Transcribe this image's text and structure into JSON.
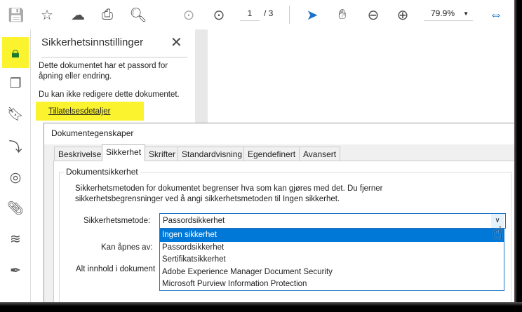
{
  "toolbar": {
    "page_current": "1",
    "page_total": "/ 3",
    "zoom": "79.9%"
  },
  "panel": {
    "title": "Sikkerhetsinnstillinger",
    "text1": "Dette dokumentet har et passord for åpning eller endring.",
    "text2": "Du kan ikke redigere dette dokumentet.",
    "link": "Tillatelsesdetaljer"
  },
  "dialog": {
    "title": "Dokumentegenskaper",
    "tabs": [
      "Beskrivelse",
      "Sikkerhet",
      "Skrifter",
      "Standardvisning",
      "Egendefinert",
      "Avansert"
    ],
    "group": "Dokumentsikkerhet",
    "desc1": "Sikkerhetsmetoden for dokumentet begrenser hva som kan gjøres med det. Du fjerner",
    "desc2": "sikkerhetsbegrensninger ved å angi sikkerhetsmetoden til Ingen sikkerhet.",
    "method_label": "Sikkerhetsmetode:",
    "method_value": "Passordsikkerhet",
    "open_label": "Kan åpnes av:",
    "content_label": "Alt innhold i dokument",
    "options": [
      "Ingen sikkerhet",
      "Passordsikkerhet",
      "Sertifikatsikkerhet",
      "Adobe Experience Manager Document Security",
      "Microsoft Purview Information Protection"
    ]
  },
  "colors": {
    "highlight": "#fbf32d",
    "accent": "#1a73c9",
    "selected": "#0078d7",
    "lock": "#1d7a2c"
  }
}
